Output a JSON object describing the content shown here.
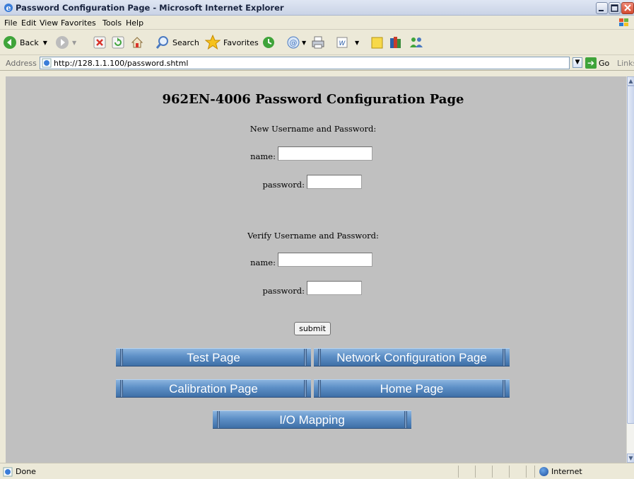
{
  "window": {
    "title": "Password Configuration Page - Microsoft Internet Explorer"
  },
  "menu": [
    "File",
    "Edit",
    "View",
    "Favorites",
    "Tools",
    "Help"
  ],
  "toolbar": {
    "back_label": "Back",
    "search_label": "Search",
    "favorites_label": "Favorites"
  },
  "address": {
    "label": "Address",
    "url": "http://128.1.1.100/password.shtml",
    "go_label": "Go",
    "links_label": "Links"
  },
  "page": {
    "heading": "962EN-4006 Password Configuration Page",
    "new_section": "New Username and Password:",
    "verify_section": "Verify Username and Password:",
    "name_label": "name:",
    "password_label": "password:",
    "submit_label": "submit",
    "nav": {
      "test": "Test Page",
      "network": "Network Configuration Page",
      "calibration": "Calibration Page",
      "home": "Home Page",
      "io": "I/O Mapping"
    }
  },
  "status": {
    "text": "Done",
    "zone": "Internet"
  },
  "colors": {
    "content_bg": "#c0c0c0",
    "nav_button": "#5d8fc6",
    "chrome": "#ece9d8"
  }
}
